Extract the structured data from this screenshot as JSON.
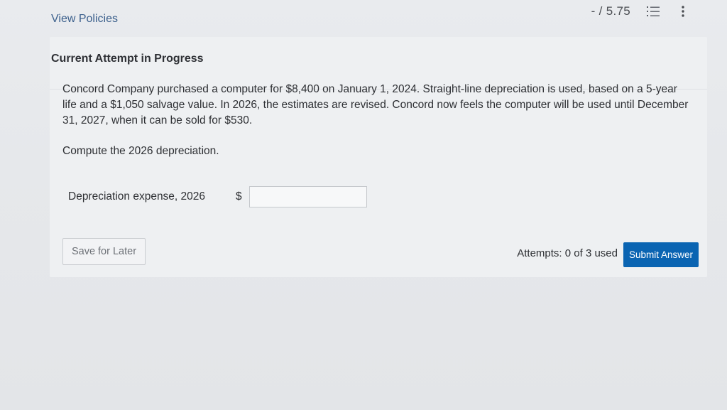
{
  "header": {
    "view_policies": "View Policies",
    "score": "- / 5.75",
    "list_icon": "list-icon",
    "more_icon": "vertical-dots-icon"
  },
  "attempt": {
    "title": "Current Attempt in Progress"
  },
  "question": {
    "text": "Concord Company purchased a computer for $8,400 on January 1, 2024. Straight-line depreciation is used, based on a 5-year life and a $1,050 salvage value. In 2026, the estimates are revised. Concord now feels the computer will be used until December 31, 2027, when it can be sold for $530.",
    "prompt": "Compute the 2026 depreciation."
  },
  "answer": {
    "label": "Depreciation expense, 2026",
    "currency": "$",
    "value": ""
  },
  "footer": {
    "save_label": "Save for Later",
    "attempts": "Attempts: 0 of 3 used",
    "submit_label": "Submit Answer"
  },
  "colors": {
    "accent": "#0a64b2",
    "link": "#3b5f8c"
  }
}
